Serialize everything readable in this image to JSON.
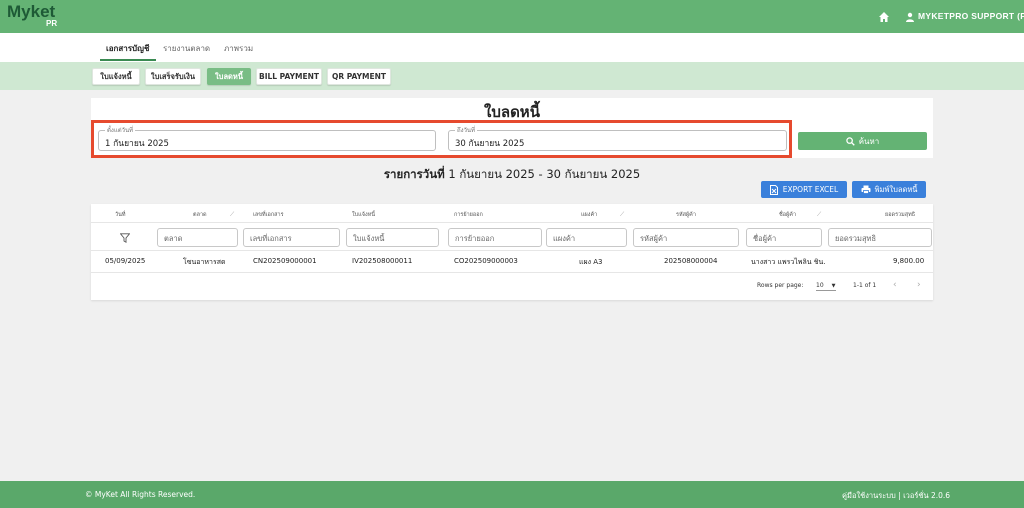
{
  "header": {
    "logo": "Myket",
    "logo_sub": "PR",
    "user_label": "MYKETPRO SUPPORT (P)"
  },
  "main_nav": {
    "items": [
      "เอกสารบัญชี",
      "รายงานตลาด",
      "ภาพรวม"
    ],
    "active": 0
  },
  "sub_nav": {
    "items": [
      "ใบแจ้งหนี้",
      "ใบเสร็จรับเงิน",
      "ใบลดหนี้",
      "BILL PAYMENT",
      "QR PAYMENT"
    ],
    "active": 2
  },
  "page": {
    "title": "ใบลดหนี้"
  },
  "filters": {
    "start_label": "ตั้งแต่วันที่",
    "start_value": "1 กันยายน 2025",
    "end_label": "ถึงวันที่",
    "end_value": "30 กันยายน 2025",
    "search_label": "ค้นหา"
  },
  "report": {
    "prefix": "รายการวันที่",
    "range": " 1 กันยายน 2025 - 30 กันยายน 2025"
  },
  "actions": {
    "export_label": "EXPORT EXCEL",
    "print_label": "พิมพ์ใบลดหนี้"
  },
  "table": {
    "columns": [
      "วันที่",
      "ตลาด",
      "เลขที่เอกสาร",
      "ใบแจ้งหนี้",
      "การย้ายออก",
      "แผงค้า",
      "รหัสผู้ค้า",
      "ชื่อผู้ค้า",
      "ยอดรวมสุทธิ"
    ],
    "filter_placeholders": [
      "ตลาด",
      "เลขที่เอกสาร",
      "ใบแจ้งหนี้",
      "การย้ายออก",
      "แผงค้า",
      "รหัสผู้ค้า",
      "ชื่อผู้ค้า",
      "ยอดรวมสุทธิ"
    ],
    "rows": [
      [
        "05/09/2025",
        "โซนอาหารสด",
        "CN202509000001",
        "IV202508000011",
        "CO202509000003",
        "แผง A3",
        "202508000004",
        "นางสาว แพรวไพลิน ชิน...",
        "9,800.00"
      ]
    ]
  },
  "pagination": {
    "rows_label": "Rows per page:",
    "rows_value": "10",
    "range": "1-1 of 1"
  },
  "footer": {
    "copyright": "© MyKet All Rights Reserved.",
    "right": "คู่มือใช้งานระบบ | เวอร์ชั่น 2.0.6"
  },
  "colors": {
    "header": "#64b374",
    "subnav": "#cfe8d2",
    "highlight": "#e64a2e",
    "primary_blue": "#3a80db",
    "footer": "#5aa86a"
  }
}
